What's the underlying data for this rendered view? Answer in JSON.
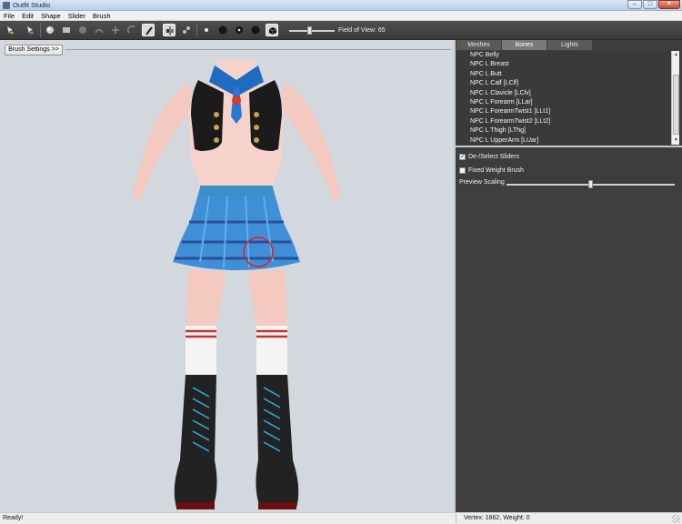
{
  "window": {
    "title": "Outfit Studio",
    "controls": [
      "–",
      "□",
      "✕"
    ]
  },
  "menu": [
    "File",
    "Edit",
    "Shape",
    "Slider",
    "Brush"
  ],
  "toolbar": {
    "fov_label": "Field of View: 65",
    "fov_value": 65,
    "tools": [
      "select-tool-icon",
      "transform-tool-icon",
      "inflate-brush-icon",
      "deflate-brush-icon",
      "move-brush-icon",
      "smooth-brush-icon",
      "undo-icon",
      "transform-icon",
      "pivot-icon",
      "weight-brush-icon",
      "mirror-icon",
      "bones-icon",
      "dot-small-icon",
      "dot-medium-icon",
      "dot-large-icon",
      "dot-xlarge-icon",
      "cube-icon"
    ]
  },
  "viewport": {
    "brush_settings_label": "Brush Settings >>"
  },
  "panel": {
    "tabs": [
      "Meshes",
      "Bones",
      "Lights"
    ],
    "selected_tab": "Bones",
    "bones": [
      "NPC Belly",
      "NPC L Breast",
      "NPC L Butt",
      "NPC L Calf [LClf]",
      "NPC L Clavicle [LClv]",
      "NPC L Forearm [LLar]",
      "NPC L ForearmTwist1 [LLt1]",
      "NPC L ForearmTwist2 [LLt2]",
      "NPC L Thigh [LThg]",
      "NPC L UpperArm [LUar]"
    ],
    "options": {
      "deselect_sliders": "De-/Select Sliders",
      "deselect_checked": true,
      "fixed_weight": "Fixed Weight Brush",
      "fixed_weight_checked": false
    },
    "preview_scaling_label": "Preview Scaling",
    "preview_scaling_value": 0.49
  },
  "status": {
    "left": "Ready!",
    "right": "Vertex: 1662, Weight: 0"
  }
}
